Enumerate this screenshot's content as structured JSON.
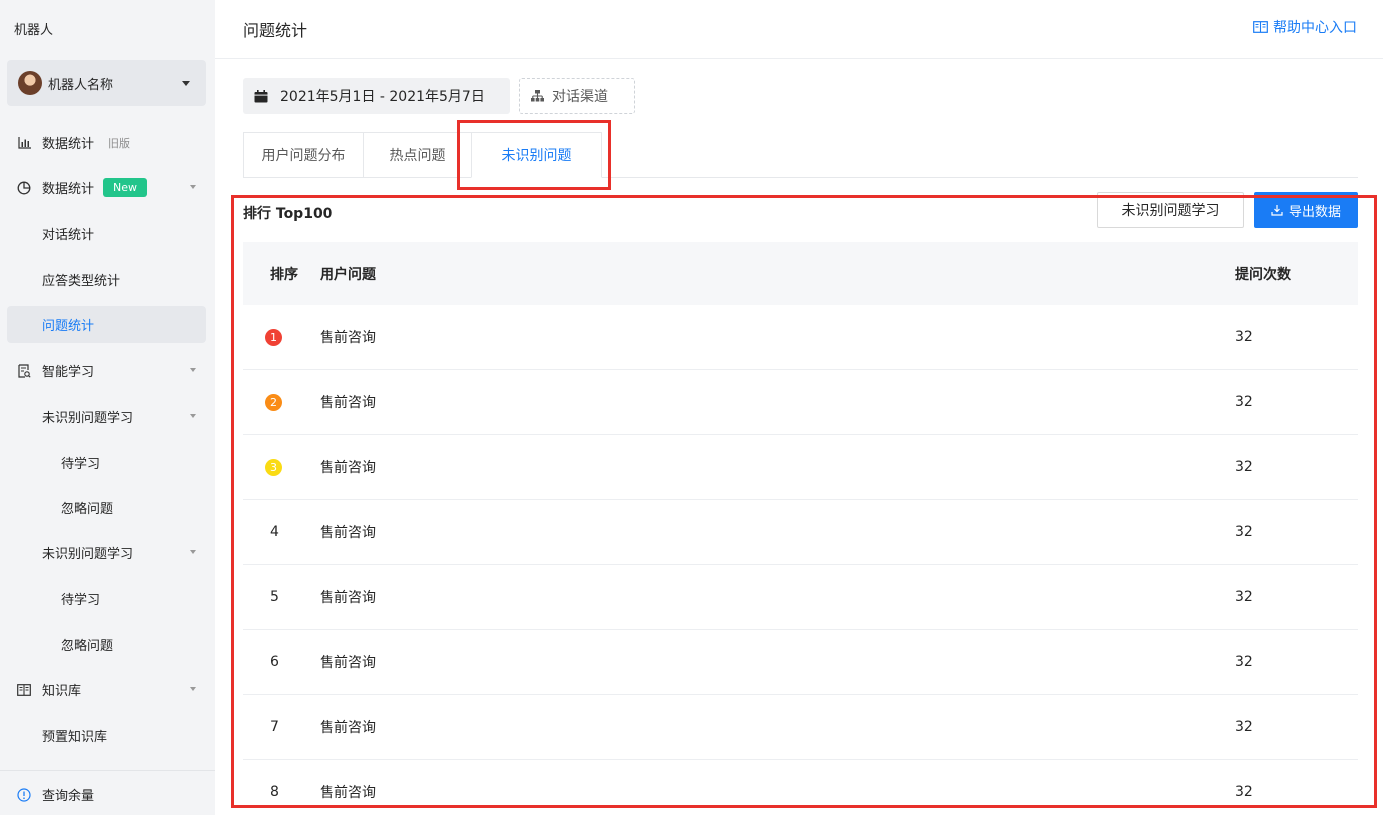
{
  "sidebar": {
    "title": "机器人",
    "robot_name": "机器人名称",
    "items": [
      {
        "label": "数据统计",
        "tag": "旧版"
      },
      {
        "label": "数据统计",
        "tag": "New"
      },
      {
        "label": "对话统计"
      },
      {
        "label": "应答类型统计"
      },
      {
        "label": "问题统计"
      },
      {
        "label": "智能学习"
      },
      {
        "label": "未识别问题学习"
      },
      {
        "label": "待学习"
      },
      {
        "label": "忽略问题"
      },
      {
        "label": "未识别问题学习"
      },
      {
        "label": "待学习"
      },
      {
        "label": "忽略问题"
      },
      {
        "label": "知识库"
      },
      {
        "label": "预置知识库"
      }
    ],
    "footer": "查询余量"
  },
  "header": {
    "title": "问题统计",
    "help": "帮助中心入口"
  },
  "filters": {
    "date_range": "2021年5月1日 - 2021年5月7日",
    "channel": "对话渠道"
  },
  "tabs": [
    "用户问题分布",
    "热点问题",
    "未识别问题"
  ],
  "active_tab": 2,
  "section": {
    "title": "排行 Top100",
    "learn_button": "未识别问题学习",
    "export_button": "导出数据"
  },
  "table": {
    "columns": [
      "排序",
      "用户问题",
      "提问次数"
    ],
    "rows": [
      {
        "rank": "1",
        "question": "售前咨询",
        "count": "32"
      },
      {
        "rank": "2",
        "question": "售前咨询",
        "count": "32"
      },
      {
        "rank": "3",
        "question": "售前咨询",
        "count": "32"
      },
      {
        "rank": "4",
        "question": "售前咨询",
        "count": "32"
      },
      {
        "rank": "5",
        "question": "售前咨询",
        "count": "32"
      },
      {
        "rank": "6",
        "question": "售前咨询",
        "count": "32"
      },
      {
        "rank": "7",
        "question": "售前咨询",
        "count": "32"
      },
      {
        "rank": "8",
        "question": "售前咨询",
        "count": "32"
      }
    ]
  },
  "colors": {
    "primary": "#1a7cf5",
    "rank1": "#f04134",
    "rank2": "#fa8c16",
    "rank3": "#fadb14",
    "new_tag": "#22c58b",
    "highlight": "#e8302a"
  }
}
